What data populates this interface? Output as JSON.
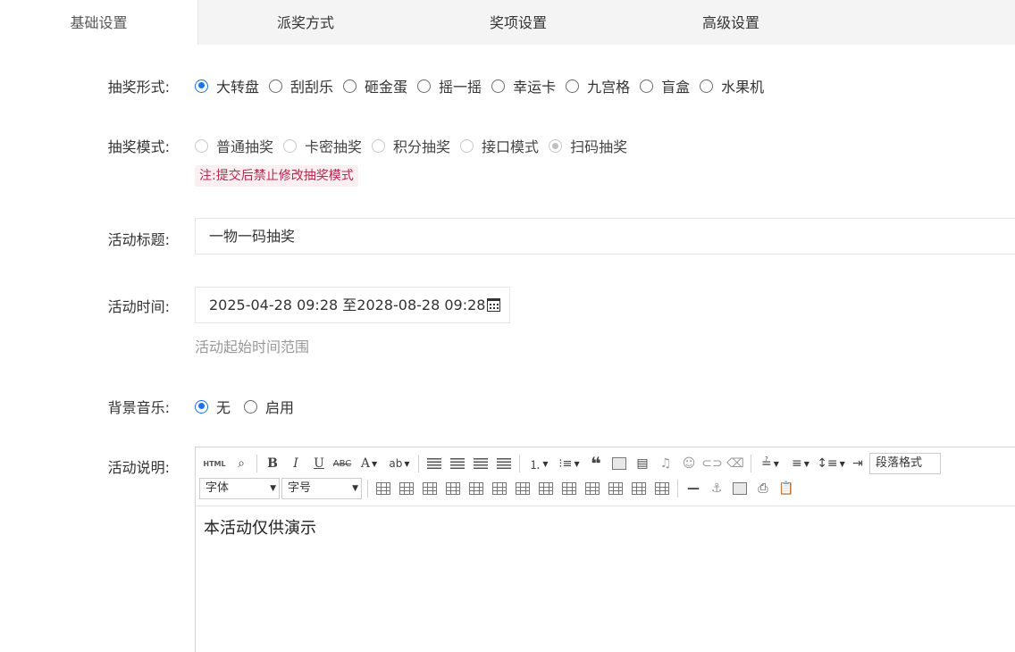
{
  "tabs": [
    "基础设置",
    "派奖方式",
    "奖项设置",
    "高级设置"
  ],
  "form": {
    "lottery_form": {
      "label": "抽奖形式:",
      "options": [
        "大转盘",
        "刮刮乐",
        "砸金蛋",
        "摇一摇",
        "幸运卡",
        "九宫格",
        "盲盒",
        "水果机"
      ],
      "selected": "大转盘"
    },
    "lottery_mode": {
      "label": "抽奖模式:",
      "options": [
        "普通抽奖",
        "卡密抽奖",
        "积分抽奖",
        "接口模式",
        "扫码抽奖"
      ],
      "selected": "扫码抽奖",
      "note": "注:提交后禁止修改抽奖模式"
    },
    "title": {
      "label": "活动标题:",
      "value": "一物一码抽奖"
    },
    "time": {
      "label": "活动时间:",
      "value": "2025-04-28 09:28 至2028-08-28 09:28",
      "help": "活动起始时间范围"
    },
    "music": {
      "label": "背景音乐:",
      "options": [
        "无",
        "启用"
      ],
      "selected": "无"
    },
    "desc": {
      "label": "活动说明:",
      "toolbar": {
        "html": "HTML",
        "paragraph_select": "段落格式",
        "font_select": "字体",
        "size_select": "字号"
      },
      "content": "本活动仅供演示"
    }
  },
  "colors": {
    "accent": "#1a73e8",
    "note_bg": "#fbeff1",
    "note_text": "#b12a4e"
  }
}
